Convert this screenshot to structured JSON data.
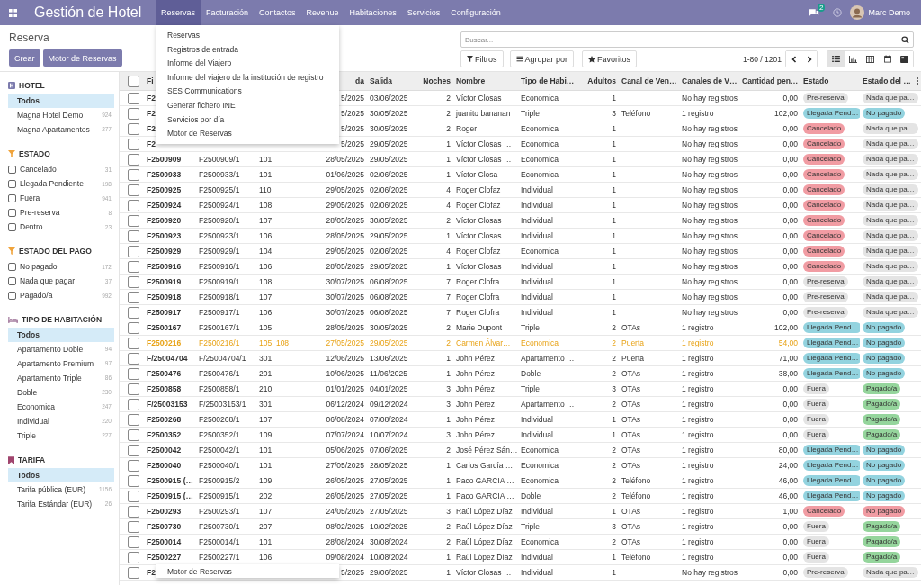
{
  "navbar": {
    "app_title": "Gestión de Hotel",
    "menu": [
      {
        "label": "Reservas",
        "selected": true
      },
      {
        "label": "Facturación",
        "selected": false
      },
      {
        "label": "Contactos",
        "selected": false
      },
      {
        "label": "Revenue",
        "selected": false
      },
      {
        "label": "Habitaciones",
        "selected": false
      },
      {
        "label": "Servicios",
        "selected": false
      },
      {
        "label": "Configuración",
        "selected": false
      }
    ],
    "messages_badge": "2",
    "user": "Marc Demo"
  },
  "dropdown": {
    "items": [
      "Reservas",
      "Registros de entrada",
      "Informe del Viajero",
      "Informe del viajero de la institución de registro",
      "SES Communications",
      "Generar fichero INE",
      "Servicios por día",
      "Motor de Reservas"
    ]
  },
  "floating_menu": {
    "item": "Motor de Reservas"
  },
  "control_panel": {
    "breadcrumb": "Reserva",
    "buttons": [
      "Crear",
      "Motor de Reservas"
    ],
    "search": {
      "placeholder": "Buscar..."
    },
    "filters": [
      "Filtros",
      "Agrupar por",
      "Favoritos"
    ],
    "pager": "1-80 / 1201",
    "views": [
      {
        "selected": true
      },
      {
        "selected": false
      },
      {
        "selected": false
      },
      {
        "selected": false
      },
      {
        "selected": false
      }
    ]
  },
  "sidebar": {
    "sections": [
      {
        "title": "HOTEL",
        "kind": "list",
        "items": [
          {
            "label": "Todos",
            "selected": true
          },
          {
            "label": "Magna Hotel Demo",
            "count": "924",
            "selected": false
          },
          {
            "label": "Magna Apartamentos",
            "count": "277",
            "selected": false
          }
        ]
      },
      {
        "title": "ESTADO",
        "kind": "checkbox",
        "items": [
          {
            "label": "Cancelado",
            "count": "31",
            "checked": false
          },
          {
            "label": "Llegada Pendiente",
            "count": "198",
            "checked": false
          },
          {
            "label": "Fuera",
            "count": "941",
            "checked": false
          },
          {
            "label": "Pre-reserva",
            "count": "8",
            "checked": false
          },
          {
            "label": "Dentro",
            "count": "23",
            "checked": false
          }
        ]
      },
      {
        "title": "ESTADO DEL PAGO",
        "kind": "checkbox",
        "items": [
          {
            "label": "No pagado",
            "count": "172",
            "checked": false
          },
          {
            "label": "Nada que pagar",
            "count": "37",
            "checked": false
          },
          {
            "label": "Pagado/a",
            "count": "992",
            "checked": false
          }
        ]
      },
      {
        "title": "TIPO DE HABITACIÓN",
        "kind": "list",
        "items": [
          {
            "label": "Todos",
            "selected": true
          },
          {
            "label": "Apartamento Doble",
            "count": "94",
            "selected": false
          },
          {
            "label": "Apartamento Premium",
            "count": "97",
            "selected": false
          },
          {
            "label": "Apartamento Triple",
            "count": "86",
            "selected": false
          },
          {
            "label": "Doble",
            "count": "230",
            "selected": false
          },
          {
            "label": "Economica",
            "count": "247",
            "selected": false
          },
          {
            "label": "Individual",
            "count": "220",
            "selected": false
          },
          {
            "label": "Triple",
            "count": "227",
            "selected": false
          }
        ]
      },
      {
        "title": "TARIFA",
        "kind": "list",
        "items": [
          {
            "label": "Todos",
            "selected": true
          },
          {
            "label": "Tarifa pública (EUR)",
            "count": "1156",
            "selected": false
          },
          {
            "label": "Tarifa Estándar (EUR)",
            "count": "26",
            "selected": false
          }
        ]
      }
    ]
  },
  "table": {
    "header_checked": false,
    "columns": [
      "Fi",
      null,
      null,
      "da",
      "Salida",
      "Noches",
      "Nombre",
      "Tipo de Habi…",
      "Adultos",
      "Canal de Ven…",
      "Canales de V…",
      "Cantidad pen…",
      "Estado",
      "Estado del …"
    ],
    "rows": [
      {
        "checked": false,
        "highlighted": false,
        "cells": [
          "F2",
          null,
          null,
          "5/2025",
          "03/06/2025",
          "2",
          "Víctor Closas",
          "Economica",
          "1",
          null,
          "No hay registros",
          "0,00"
        ],
        "state": {
          "text": "Pre-reserva",
          "color": "#e4e4e4"
        },
        "payment": {
          "text": "Nada que pa…",
          "color": "#e4e4e4"
        }
      },
      {
        "checked": false,
        "highlighted": false,
        "cells": [
          "F2",
          null,
          null,
          "5/2025",
          "30/05/2025",
          "2",
          "juanito bananan",
          "Triple",
          "3",
          "Teléfono",
          "1 registro",
          "102,00"
        ],
        "state": {
          "text": "Llegada Pend…",
          "color": "#93d3df"
        },
        "payment": {
          "text": "No pagado",
          "color": "#93d3df"
        }
      },
      {
        "checked": false,
        "highlighted": false,
        "cells": [
          "F2",
          null,
          null,
          "5/2025",
          "30/05/2025",
          "2",
          "Roger",
          "Economica",
          "1",
          null,
          "No hay registros",
          "0,00"
        ],
        "state": {
          "text": "Cancelado",
          "color": "#f19ca3"
        },
        "payment": {
          "text": "Nada que pa…",
          "color": "#e4e4e4"
        }
      },
      {
        "checked": false,
        "highlighted": false,
        "cells": [
          "F2",
          null,
          null,
          "5/2025",
          "29/05/2025",
          "1",
          "Víctor Closas …",
          "Economica",
          "1",
          null,
          "No hay registros",
          "0,00"
        ],
        "state": {
          "text": "Cancelado",
          "color": "#f19ca3"
        },
        "payment": {
          "text": "Nada que pa…",
          "color": "#e4e4e4"
        }
      },
      {
        "checked": false,
        "highlighted": false,
        "cells": [
          "F2500909",
          "F2500909/1",
          "101",
          "28/05/2025",
          "29/05/2025",
          "1",
          "Víctor Closas …",
          "Economica",
          "1",
          null,
          "No hay registros",
          "0,00"
        ],
        "state": {
          "text": "Cancelado",
          "color": "#f19ca3"
        },
        "payment": {
          "text": "Nada que pa…",
          "color": "#e4e4e4"
        }
      },
      {
        "checked": false,
        "highlighted": false,
        "cells": [
          "F2500933",
          "F2500933/1",
          "101",
          "01/06/2025",
          "02/06/2025",
          "1",
          "Víctor Closa",
          "Economica",
          "1",
          null,
          "No hay registros",
          "0,00"
        ],
        "state": {
          "text": "Cancelado",
          "color": "#f19ca3"
        },
        "payment": {
          "text": "Nada que pa…",
          "color": "#e4e4e4"
        }
      },
      {
        "checked": false,
        "highlighted": false,
        "cells": [
          "F2500925",
          "F2500925/1",
          "110",
          "29/05/2025",
          "02/06/2025",
          "4",
          "Roger Clofaz",
          "Individual",
          "1",
          null,
          "No hay registros",
          "0,00"
        ],
        "state": {
          "text": "Cancelado",
          "color": "#f19ca3"
        },
        "payment": {
          "text": "Nada que pa…",
          "color": "#e4e4e4"
        }
      },
      {
        "checked": false,
        "highlighted": false,
        "cells": [
          "F2500924",
          "F2500924/1",
          "108",
          "29/05/2025",
          "02/06/2025",
          "4",
          "Roger Clofaz",
          "Individual",
          "1",
          null,
          "No hay registros",
          "0,00"
        ],
        "state": {
          "text": "Cancelado",
          "color": "#f19ca3"
        },
        "payment": {
          "text": "Nada que pa…",
          "color": "#e4e4e4"
        }
      },
      {
        "checked": false,
        "highlighted": false,
        "cells": [
          "F2500920",
          "F2500920/1",
          "107",
          "28/05/2025",
          "30/05/2025",
          "2",
          "Víctor Closas",
          "Individual",
          "1",
          null,
          "No hay registros",
          "0,00"
        ],
        "state": {
          "text": "Cancelado",
          "color": "#f19ca3"
        },
        "payment": {
          "text": "Nada que pa…",
          "color": "#e4e4e4"
        }
      },
      {
        "checked": false,
        "highlighted": false,
        "cells": [
          "F2500923",
          "F2500923/1",
          "106",
          "28/05/2025",
          "29/05/2025",
          "1",
          "Víctor Closas",
          "Individual",
          "1",
          null,
          "No hay registros",
          "0,00"
        ],
        "state": {
          "text": "Cancelado",
          "color": "#f19ca3"
        },
        "payment": {
          "text": "Nada que pa…",
          "color": "#e4e4e4"
        }
      },
      {
        "checked": false,
        "highlighted": false,
        "cells": [
          "F2500929",
          "F2500929/1",
          "104",
          "29/05/2025",
          "02/06/2025",
          "4",
          "Roger Clofaz",
          "Economica",
          "1",
          null,
          "No hay registros",
          "0,00"
        ],
        "state": {
          "text": "Cancelado",
          "color": "#f19ca3"
        },
        "payment": {
          "text": "Nada que pa…",
          "color": "#e4e4e4"
        }
      },
      {
        "checked": false,
        "highlighted": false,
        "cells": [
          "F2500916",
          "F2500916/1",
          "106",
          "28/05/2025",
          "29/05/2025",
          "1",
          "Víctor Closas",
          "Individual",
          "1",
          null,
          "No hay registros",
          "0,00"
        ],
        "state": {
          "text": "Cancelado",
          "color": "#f19ca3"
        },
        "payment": {
          "text": "Nada que pa…",
          "color": "#e4e4e4"
        }
      },
      {
        "checked": false,
        "highlighted": false,
        "cells": [
          "F2500919",
          "F2500919/1",
          "108",
          "30/07/2025",
          "06/08/2025",
          "7",
          "Roger Clofra",
          "Individual",
          "1",
          null,
          "No hay registros",
          "0,00"
        ],
        "state": {
          "text": "Pre-reserva",
          "color": "#e4e4e4"
        },
        "payment": {
          "text": "Nada que pa…",
          "color": "#e4e4e4"
        }
      },
      {
        "checked": false,
        "highlighted": false,
        "cells": [
          "F2500918",
          "F2500918/1",
          "107",
          "30/07/2025",
          "06/08/2025",
          "7",
          "Roger Clofra",
          "Individual",
          "1",
          null,
          "No hay registros",
          "0,00"
        ],
        "state": {
          "text": "Pre-reserva",
          "color": "#e4e4e4"
        },
        "payment": {
          "text": "Nada que pa…",
          "color": "#e4e4e4"
        }
      },
      {
        "checked": false,
        "highlighted": false,
        "cells": [
          "F2500917",
          "F2500917/1",
          "106",
          "30/07/2025",
          "06/08/2025",
          "7",
          "Roger Clofra",
          "Individual",
          "1",
          null,
          "No hay registros",
          "0,00"
        ],
        "state": {
          "text": "Pre-reserva",
          "color": "#e4e4e4"
        },
        "payment": {
          "text": "Nada que pa…",
          "color": "#e4e4e4"
        }
      },
      {
        "checked": false,
        "highlighted": false,
        "cells": [
          "F2500167",
          "F2500167/1",
          "105",
          "28/05/2025",
          "30/05/2025",
          "2",
          "Marie Dupont",
          "Triple",
          "2",
          "OTAs",
          "1 registro",
          "102,00"
        ],
        "state": {
          "text": "Llegada Pend…",
          "color": "#93d3df"
        },
        "payment": {
          "text": "No pagado",
          "color": "#93d3df"
        }
      },
      {
        "checked": false,
        "highlighted": true,
        "cells": [
          "F2500216",
          "F2500216/1",
          "105, 108",
          "27/05/2025",
          "29/05/2025",
          "2",
          "Carmen Álvar…",
          "Economica",
          "2",
          "Puerta",
          "1 registro",
          "54,00"
        ],
        "state": {
          "text": "Llegada Pend…",
          "color": "#93d3df"
        },
        "payment": {
          "text": "No pagado",
          "color": "#93d3df"
        }
      },
      {
        "checked": false,
        "highlighted": false,
        "cells": [
          "F/25004704",
          "F/25004704/1",
          "301",
          "12/06/2025",
          "13/06/2025",
          "1",
          "John Pérez",
          "Apartamento …",
          "2",
          "Puerta",
          "1 registro",
          "71,00"
        ],
        "state": {
          "text": "Llegada Pend…",
          "color": "#93d3df"
        },
        "payment": {
          "text": "No pagado",
          "color": "#93d3df"
        }
      },
      {
        "checked": false,
        "highlighted": false,
        "cells": [
          "F2500476",
          "F2500476/1",
          "201",
          "10/06/2025",
          "11/06/2025",
          "1",
          "John Pérez",
          "Doble",
          "2",
          "OTAs",
          "1 registro",
          "38,00"
        ],
        "state": {
          "text": "Llegada Pend…",
          "color": "#93d3df"
        },
        "payment": {
          "text": "No pagado",
          "color": "#93d3df"
        }
      },
      {
        "checked": false,
        "highlighted": false,
        "cells": [
          "F2500858",
          "F2500858/1",
          "210",
          "01/01/2025",
          "04/01/2025",
          "3",
          "John Pérez",
          "Triple",
          "3",
          "OTAs",
          "1 registro",
          "0,00"
        ],
        "state": {
          "text": "Fuera",
          "color": "#e4e4e4"
        },
        "payment": {
          "text": "Pagado/a",
          "color": "#95d59c"
        }
      },
      {
        "checked": false,
        "highlighted": false,
        "cells": [
          "F/25003153",
          "F/25003153/1",
          "301",
          "06/12/2024",
          "09/12/2024",
          "3",
          "John Pérez",
          "Apartamento …",
          "2",
          "OTAs",
          "1 registro",
          "0,00"
        ],
        "state": {
          "text": "Fuera",
          "color": "#e4e4e4"
        },
        "payment": {
          "text": "Pagado/a",
          "color": "#95d59c"
        }
      },
      {
        "checked": false,
        "highlighted": false,
        "cells": [
          "F2500268",
          "F2500268/1",
          "107",
          "06/08/2024",
          "07/08/2024",
          "1",
          "John Pérez",
          "Individual",
          "1",
          "OTAs",
          "1 registro",
          "0,00"
        ],
        "state": {
          "text": "Fuera",
          "color": "#e4e4e4"
        },
        "payment": {
          "text": "Pagado/a",
          "color": "#95d59c"
        }
      },
      {
        "checked": false,
        "highlighted": false,
        "cells": [
          "F2500352",
          "F2500352/1",
          "109",
          "07/07/2024",
          "10/07/2024",
          "3",
          "John Pérez",
          "Individual",
          "1",
          "OTAs",
          "1 registro",
          "0,00"
        ],
        "state": {
          "text": "Fuera",
          "color": "#e4e4e4"
        },
        "payment": {
          "text": "Pagado/a",
          "color": "#95d59c"
        }
      },
      {
        "checked": false,
        "highlighted": false,
        "cells": [
          "F2500042",
          "F2500042/1",
          "101",
          "05/06/2025",
          "07/06/2025",
          "2",
          "José Pérez Sán…",
          "Economica",
          "2",
          "OTAs",
          "1 registro",
          "80,00"
        ],
        "state": {
          "text": "Llegada Pend…",
          "color": "#93d3df"
        },
        "payment": {
          "text": "No pagado",
          "color": "#93d3df"
        }
      },
      {
        "checked": false,
        "highlighted": false,
        "cells": [
          "F2500040",
          "F2500040/1",
          "101",
          "27/05/2025",
          "28/05/2025",
          "1",
          "Carlos García …",
          "Economica",
          "2",
          "OTAs",
          "1 registro",
          "24,00"
        ],
        "state": {
          "text": "Llegada Pend…",
          "color": "#93d3df"
        },
        "payment": {
          "text": "No pagado",
          "color": "#93d3df"
        }
      },
      {
        "checked": false,
        "highlighted": false,
        "cells": [
          "F2500915 (…",
          "F2500915/2",
          "109",
          "26/05/2025",
          "27/05/2025",
          "1",
          "Paco GARCIA …",
          "Economica",
          "2",
          "Teléfono",
          "1 registro",
          "46,00"
        ],
        "state": {
          "text": "Llegada Pend…",
          "color": "#93d3df"
        },
        "payment": {
          "text": "No pagado",
          "color": "#93d3df"
        }
      },
      {
        "checked": false,
        "highlighted": false,
        "cells": [
          "F2500915 (…",
          "F2500915/1",
          "202",
          "26/05/2025",
          "27/05/2025",
          "1",
          "Paco GARCIA …",
          "Doble",
          "2",
          "Teléfono",
          "1 registro",
          "46,00"
        ],
        "state": {
          "text": "Llegada Pend…",
          "color": "#93d3df"
        },
        "payment": {
          "text": "No pagado",
          "color": "#93d3df"
        }
      },
      {
        "checked": false,
        "highlighted": false,
        "cells": [
          "F2500293",
          "F2500293/1",
          "107",
          "24/05/2025",
          "27/05/2025",
          "3",
          "Raúl López Díaz",
          "Individual",
          "1",
          "OTAs",
          "1 registro",
          "1,00"
        ],
        "state": {
          "text": "Cancelado",
          "color": "#f19ca3"
        },
        "payment": {
          "text": "No pagado",
          "color": "#f19ca3"
        }
      },
      {
        "checked": false,
        "highlighted": false,
        "cells": [
          "F2500730",
          "F2500730/1",
          "207",
          "08/02/2025",
          "10/02/2025",
          "2",
          "Raúl López Díaz",
          "Triple",
          "3",
          "OTAs",
          "1 registro",
          "0,00"
        ],
        "state": {
          "text": "Fuera",
          "color": "#e4e4e4"
        },
        "payment": {
          "text": "Pagado/a",
          "color": "#95d59c"
        }
      },
      {
        "checked": false,
        "highlighted": false,
        "cells": [
          "F2500014",
          "F2500014/1",
          "101",
          "28/08/2024",
          "30/08/2024",
          "2",
          "Raúl López Díaz",
          "Economica",
          "2",
          "OTAs",
          "1 registro",
          "0,00"
        ],
        "state": {
          "text": "Fuera",
          "color": "#e4e4e4"
        },
        "payment": {
          "text": "Pagado/a",
          "color": "#95d59c"
        }
      },
      {
        "checked": false,
        "highlighted": false,
        "cells": [
          "F2500227",
          "F2500227/1",
          "106",
          "09/08/2024",
          "10/08/2024",
          "1",
          "Raúl López Díaz",
          "Individual",
          "1",
          "Teléfono",
          "1 registro",
          "0,00"
        ],
        "state": {
          "text": "Fuera",
          "color": "#e4e4e4"
        },
        "payment": {
          "text": "Pagado/a",
          "color": "#95d59c"
        }
      },
      {
        "checked": false,
        "highlighted": false,
        "cells": [
          "F2",
          null,
          null,
          "5/2025",
          "29/06/2025",
          "1",
          "Víctor Closas …",
          "Individual",
          "1",
          null,
          "No hay registros",
          "0,00"
        ],
        "state": {
          "text": "Pre-reserva",
          "color": "#e4e4e4"
        },
        "payment": {
          "text": "Nada que pa…",
          "color": "#e4e4e4"
        }
      }
    ]
  }
}
